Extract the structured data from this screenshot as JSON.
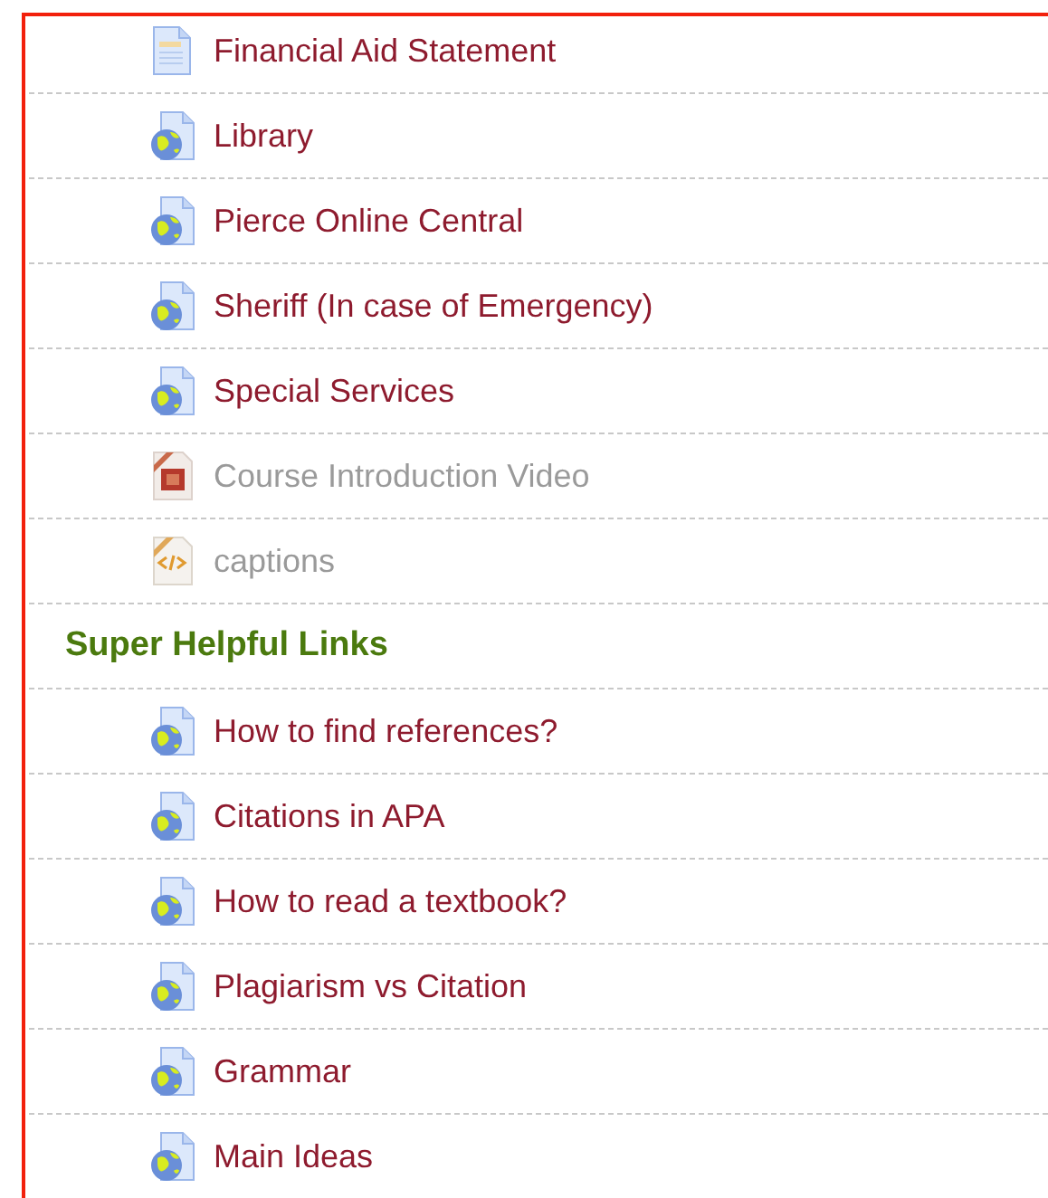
{
  "sections": [
    {
      "items": [
        {
          "label": "Financial Aid Statement",
          "kind": "file",
          "dimmed": false
        },
        {
          "label": "Library",
          "kind": "url",
          "dimmed": false
        },
        {
          "label": "Pierce Online Central",
          "kind": "url",
          "dimmed": false
        },
        {
          "label": "Sheriff (In case of Emergency)",
          "kind": "url",
          "dimmed": false
        },
        {
          "label": "Special Services",
          "kind": "url",
          "dimmed": false
        },
        {
          "label": "Course Introduction Video",
          "kind": "flash",
          "dimmed": true
        },
        {
          "label": "captions",
          "kind": "code",
          "dimmed": true
        }
      ]
    },
    {
      "title": "Super Helpful Links",
      "items": [
        {
          "label": "How to find references?",
          "kind": "url",
          "dimmed": false
        },
        {
          "label": "Citations in APA",
          "kind": "url",
          "dimmed": false
        },
        {
          "label": "How to read a textbook?",
          "kind": "url",
          "dimmed": false
        },
        {
          "label": "Plagiarism vs Citation",
          "kind": "url",
          "dimmed": false
        },
        {
          "label": "Grammar",
          "kind": "url",
          "dimmed": false
        },
        {
          "label": "Main Ideas",
          "kind": "url",
          "dimmed": false
        }
      ]
    }
  ]
}
